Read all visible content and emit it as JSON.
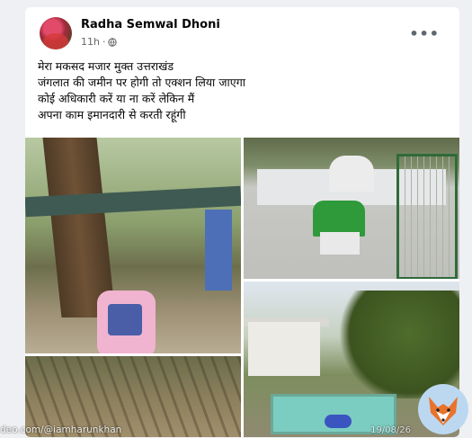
{
  "post": {
    "author": "Radha Semwal Dhoni",
    "time": "11h",
    "privacy_icon": "globe-icon",
    "menu_icon": "more-icon",
    "text_lines": [
      "मेरा मकसद मजार मुक्त उत्तराखंड",
      "जंगलात की जमीन पर होगी तो एक्शन लिया जाएगा",
      "कोई अधिकारी करें या ना करें लेकिन मैं",
      "अपना काम इमानदारी से करती रहूंगी"
    ]
  },
  "overlay": {
    "watermark": "deo.com/@iamharunkhan",
    "date": "19/08/26"
  },
  "colors": {
    "background": "#eef0f3",
    "card": "#ffffff",
    "tomb_green": "#2f9a3a"
  }
}
